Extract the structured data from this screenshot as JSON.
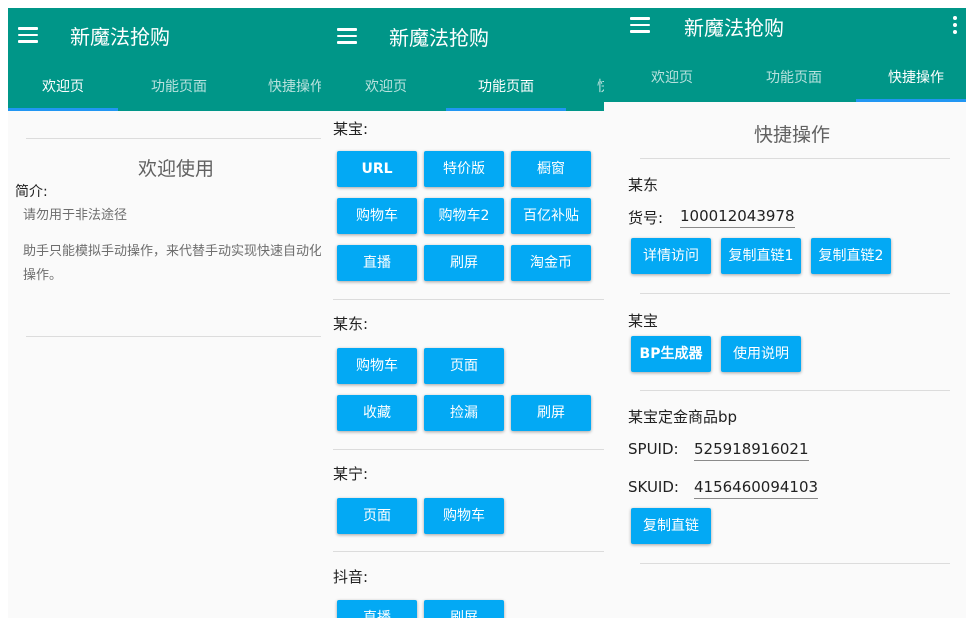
{
  "app_title": "新魔法抢购",
  "panel1": {
    "tabs": [
      "欢迎页",
      "功能页面",
      "快捷操作"
    ],
    "welcome_heading": "欢迎使用",
    "intro_label": "简介:",
    "notice": "请勿用于非法途径",
    "description": "助手只能模拟手动操作，来代替手动实现快速自动化操作。"
  },
  "panel2": {
    "tabs": [
      "欢迎页",
      "功能页面",
      "快"
    ],
    "sections": [
      {
        "label": "某宝:",
        "buttons": [
          "URL",
          "特价版",
          "橱窗",
          "购物车",
          "购物车2",
          "百亿补贴",
          "直播",
          "刷屏",
          "淘金币"
        ]
      },
      {
        "label": "某东:",
        "buttons": [
          "购物车",
          "页面",
          "收藏",
          "捡漏",
          "刷屏"
        ]
      },
      {
        "label": "某宁:",
        "buttons": [
          "页面",
          "购物车"
        ]
      },
      {
        "label": "抖音:",
        "buttons": [
          "直播",
          "刷屏"
        ]
      }
    ]
  },
  "panel3": {
    "tabs": [
      "欢迎页",
      "功能页面",
      "快捷操作"
    ],
    "heading": "快捷操作",
    "jd": {
      "label": "某东",
      "sku_label": "货号:",
      "sku_value": "100012043978",
      "buttons": [
        "详情访问",
        "复制直链1",
        "复制直链2"
      ]
    },
    "tb": {
      "label": "某宝",
      "buttons": [
        "BP生成器",
        "使用说明"
      ]
    },
    "deposit": {
      "label": "某宝定金商品bp",
      "spuid_label": "SPUID:",
      "spuid_value": "525918916021",
      "skuid_label": "SKUID:",
      "skuid_value": "4156460094103",
      "button": "复制直链"
    }
  },
  "colors": {
    "appbar": "#009688",
    "indicator": "#2196f3",
    "button": "#03a9f4"
  }
}
